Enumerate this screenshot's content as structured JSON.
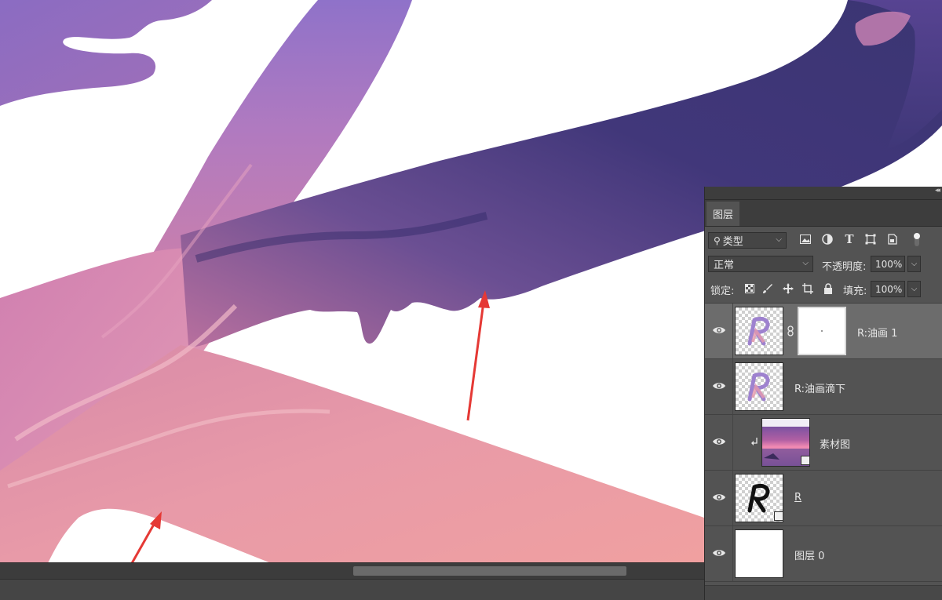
{
  "layers_panel": {
    "tab_label": "图层",
    "filter": {
      "label": "类型"
    },
    "blend_mode": "正常",
    "opacity_label": "不透明度:",
    "opacity_value": "100%",
    "lock_label": "锁定:",
    "fill_label": "填充:",
    "fill_value": "100%",
    "layers": [
      {
        "name": "R:油画 1",
        "active": true,
        "has_mask": true,
        "clipped": false,
        "thumb": "purple-r"
      },
      {
        "name": "R:油画滴下",
        "active": false,
        "has_mask": false,
        "clipped": false,
        "thumb": "purple-r"
      },
      {
        "name": "素材图",
        "active": false,
        "has_mask": false,
        "clipped": true,
        "thumb": "sunset-photo"
      },
      {
        "name": "R",
        "active": false,
        "has_mask": false,
        "clipped": false,
        "thumb": "black-r"
      },
      {
        "name": "图层 0",
        "active": false,
        "has_mask": false,
        "clipped": false,
        "thumb": "white"
      }
    ]
  },
  "colors": {
    "panel_bg": "#535353",
    "active_layer": "#6c6c6c",
    "arrow": "#e53935",
    "paint_purple": "#8a64b8",
    "paint_pink": "#e8909e",
    "paint_navy": "#3e3575"
  }
}
